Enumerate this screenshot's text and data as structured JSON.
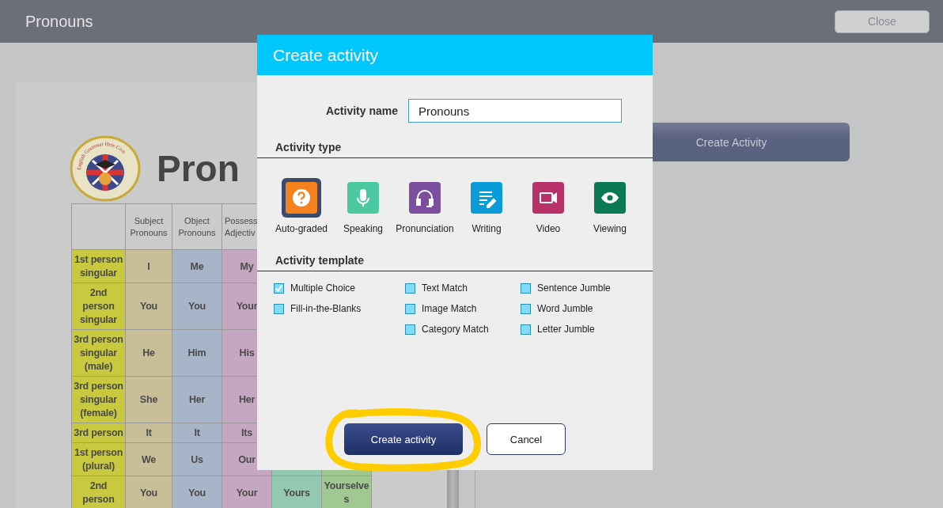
{
  "top_bar": {
    "title": "Pronouns",
    "close_button": "Close"
  },
  "document": {
    "logo_text": "English Grammar Here.Com",
    "title": "Pron",
    "columns": [
      {
        "header": "Subject\nPronouns",
        "color": "#c8bf98"
      },
      {
        "header": "Object\nPronouns",
        "color": "#a8b4c8"
      },
      {
        "header": "Possess\nAdjectiv",
        "color": "#c6a7c2"
      },
      {
        "color": "#94c8b0"
      },
      {
        "color": "#9fc893"
      }
    ],
    "rows": [
      {
        "label": "1st person\nsingular",
        "cells": [
          "I",
          "Me",
          "My"
        ]
      },
      {
        "label": "2nd\nperson\nsingular",
        "cells": [
          "You",
          "You",
          "Your"
        ]
      },
      {
        "label": "3rd person\nsingular\n(male)",
        "cells": [
          "He",
          "Him",
          "His"
        ]
      },
      {
        "label": "3rd person\nsingular\n(female)",
        "cells": [
          "She",
          "Her",
          "Her"
        ]
      },
      {
        "label": "3rd person",
        "cells": [
          "It",
          "It",
          "Its"
        ]
      },
      {
        "label": "1st person\n(plural)",
        "cells": [
          "We",
          "Us",
          "Our"
        ]
      },
      {
        "label": "2nd\nperson",
        "cells": [
          "You",
          "You",
          "Your",
          "Yours",
          "Yourselves"
        ]
      }
    ]
  },
  "background_button": "Create Activity",
  "dialog": {
    "title": "Create activity",
    "name_label": "Activity name",
    "name_value": "Pronouns",
    "type_heading": "Activity type",
    "types": [
      {
        "kind": "auto",
        "label": "Auto-graded",
        "color": "#f5821f",
        "selected": true
      },
      {
        "kind": "speaking",
        "label": "Speaking",
        "color": "#4cc9a0",
        "selected": false
      },
      {
        "kind": "pronunciation",
        "label": "Pronunciation",
        "color": "#7b4f9d",
        "selected": false
      },
      {
        "kind": "writing",
        "label": "Writing",
        "color": "#0a9bd9",
        "selected": false
      },
      {
        "kind": "video",
        "label": "Video",
        "color": "#b8326a",
        "selected": false
      },
      {
        "kind": "viewing",
        "label": "Viewing",
        "color": "#0b7a53",
        "selected": false
      }
    ],
    "template_heading": "Activity template",
    "template_columns": [
      [
        {
          "label": "Multiple Choice",
          "checked": true
        },
        {
          "label": "Fill-in-the-Blanks",
          "checked": false
        }
      ],
      [
        {
          "label": "Text Match",
          "checked": false
        },
        {
          "label": "Image Match",
          "checked": false
        },
        {
          "label": "Category Match",
          "checked": false
        }
      ],
      [
        {
          "label": "Sentence Jumble",
          "checked": false
        },
        {
          "label": "Word Jumble",
          "checked": false
        },
        {
          "label": "Letter Jumble",
          "checked": false
        }
      ]
    ],
    "create_button": "Create activity",
    "cancel_button": "Cancel"
  }
}
